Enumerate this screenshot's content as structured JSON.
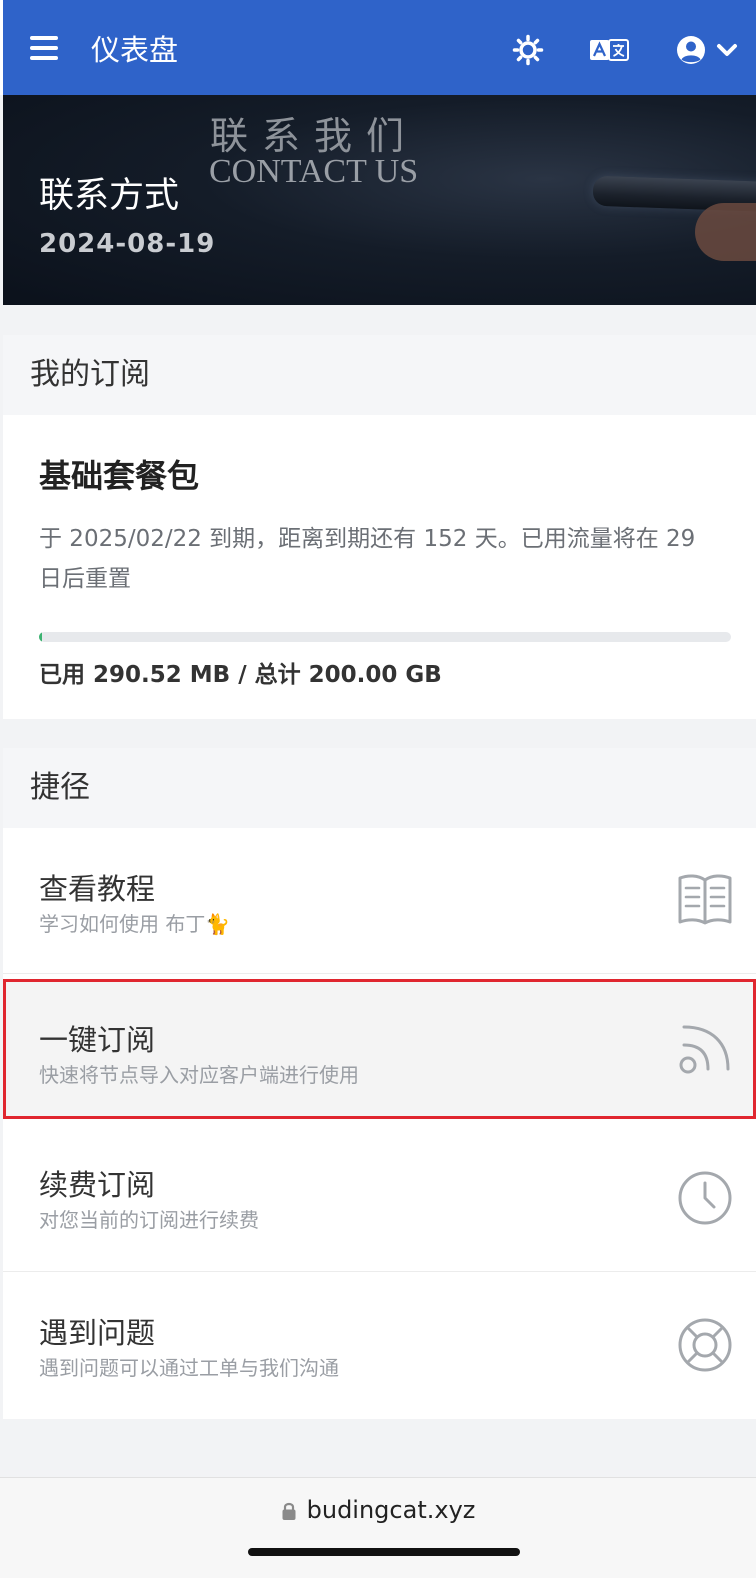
{
  "topbar": {
    "title": "仪表盘",
    "icons": [
      "menu-icon",
      "sun-icon",
      "translate-icon",
      "user-icon",
      "chevron-down-icon"
    ],
    "color": "#2f63c9"
  },
  "banner": {
    "image_text_cn": "联系我们",
    "image_text_en": "CONTACT US",
    "title": "联系方式",
    "date": "2024-08-19"
  },
  "subscription": {
    "header": "我的订阅",
    "plan_name": "基础套餐包",
    "description": "于 2025/02/22 到期，距离到期还有 152 天。已用流量将在 29 日后重置",
    "usage_fraction": 0.0014,
    "usage_text": "已用 290.52 MB / 总计 200.00 GB"
  },
  "shortcuts": {
    "header": "捷径",
    "items": [
      {
        "title": "查看教程",
        "subtitle": "学习如何使用 布丁🐈",
        "icon": "book-icon"
      },
      {
        "title": "一键订阅",
        "subtitle": "快速将节点导入对应客户端进行使用",
        "icon": "rss-icon",
        "selected": true
      },
      {
        "title": "续费订阅",
        "subtitle": "对您当前的订阅进行续费",
        "icon": "clock-icon"
      },
      {
        "title": "遇到问题",
        "subtitle": "遇到问题可以通过工单与我们沟通",
        "icon": "lifebuoy-icon"
      }
    ]
  },
  "browser": {
    "url": "budingcat.xyz",
    "icon": "lock-icon"
  }
}
